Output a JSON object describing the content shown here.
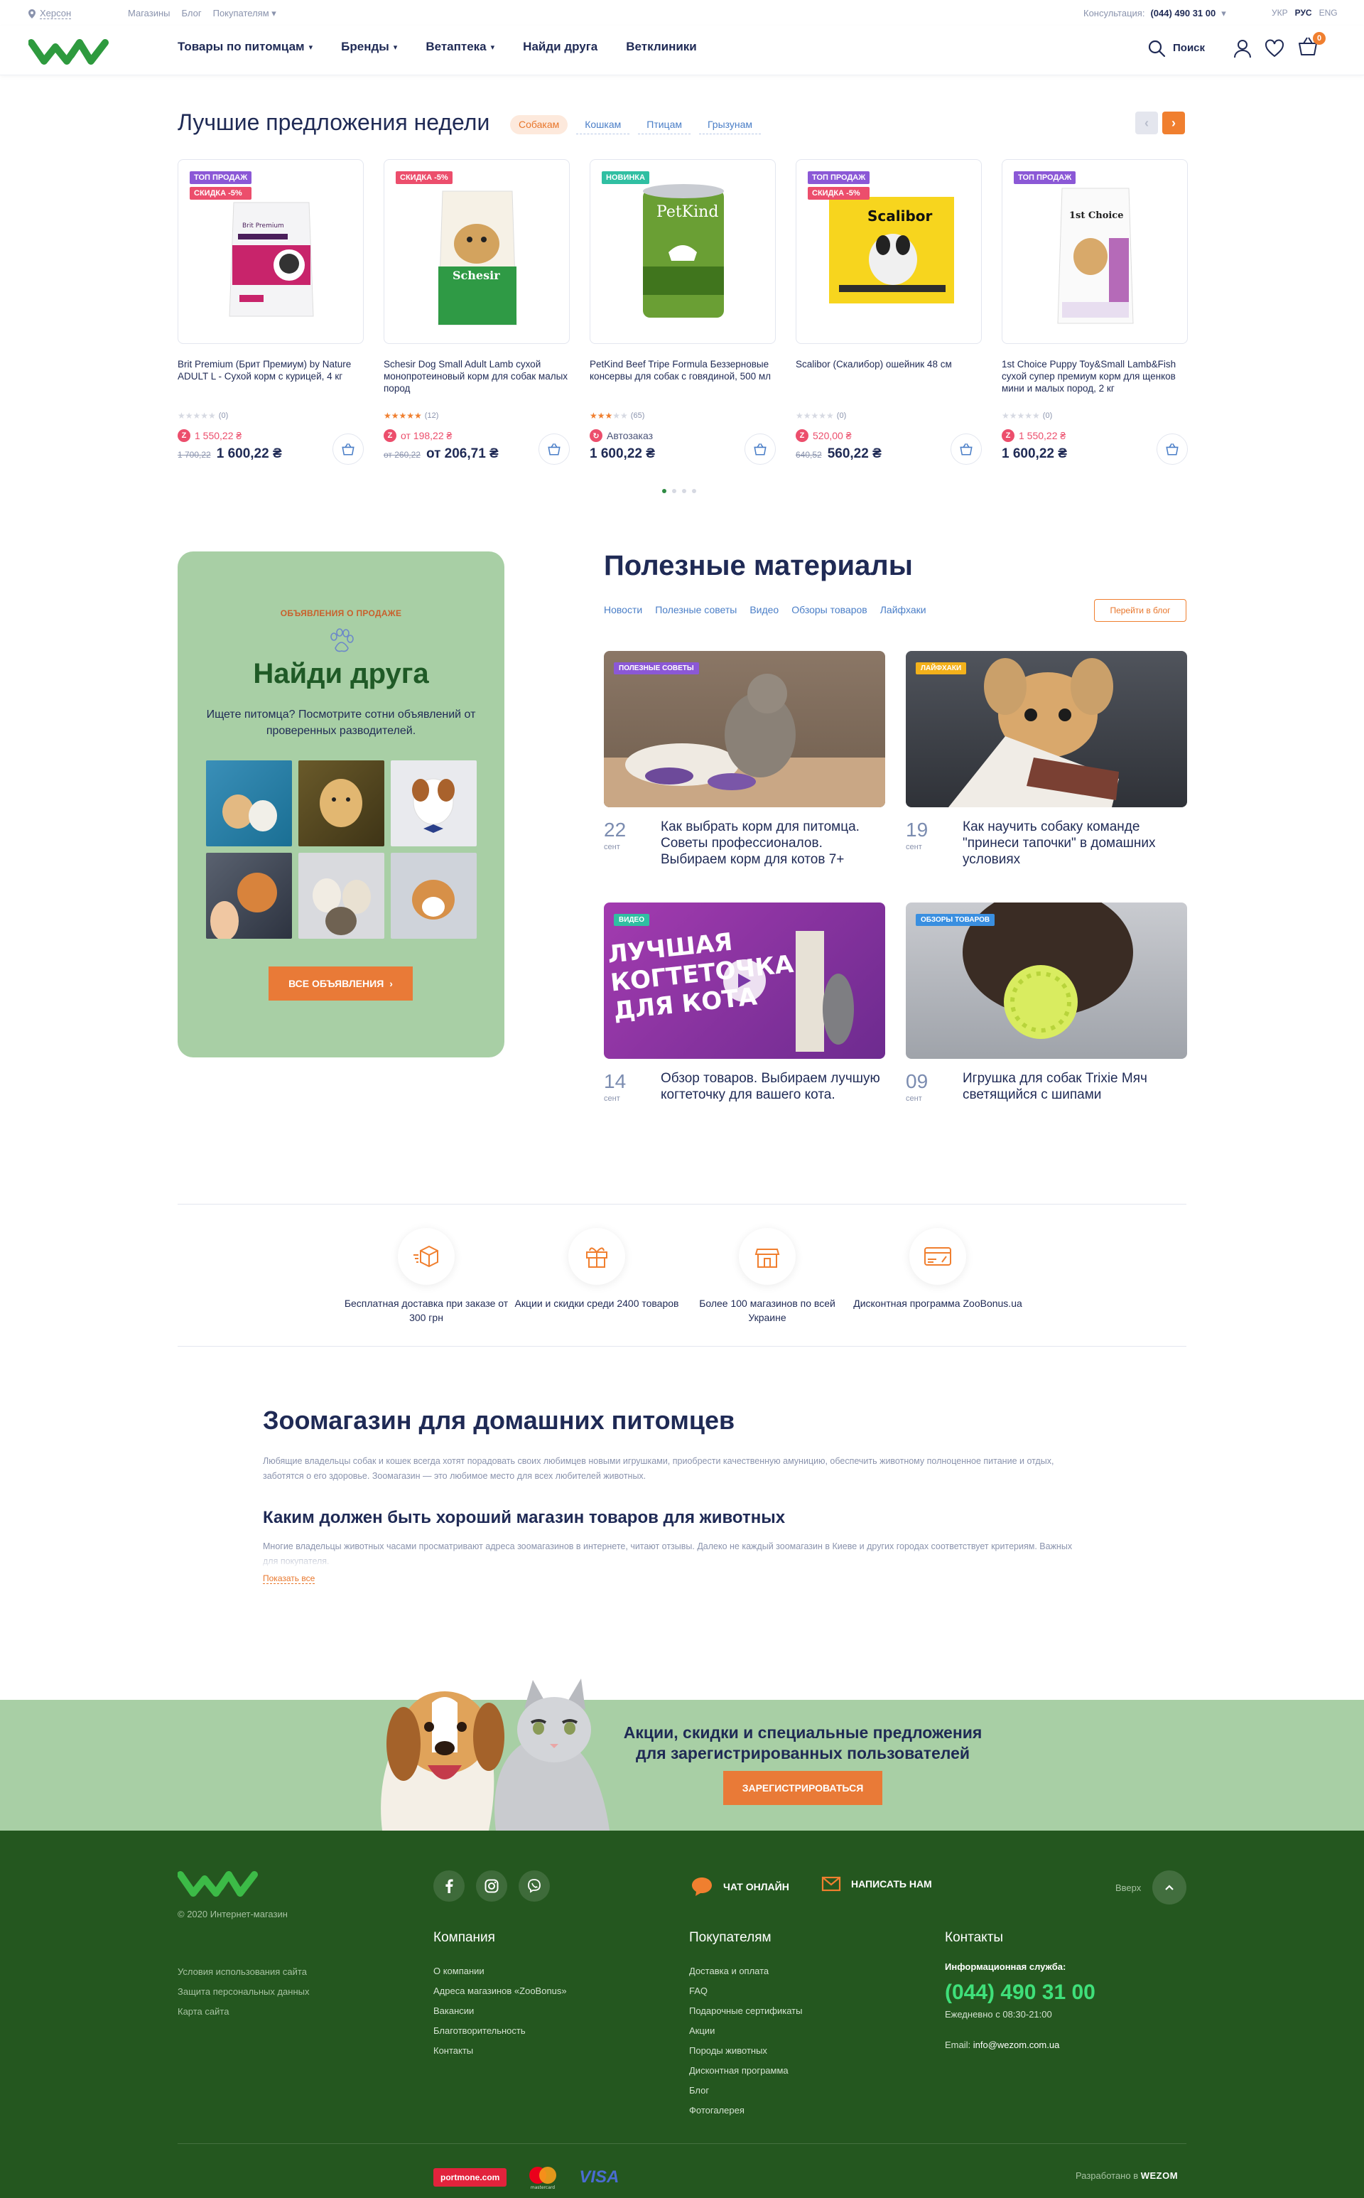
{
  "header": {
    "city": "Херсон",
    "top_links": [
      "Магазины",
      "Блог",
      "Покупателям"
    ],
    "consult_label": "Консультация:",
    "consult_phone": "(044) 490 31 00",
    "langs": [
      "УКР",
      "РУС",
      "ENG"
    ],
    "nav": [
      "Товары по питомцам",
      "Бренды",
      "Ветаптека",
      "Найди друга",
      "Ветклиники"
    ],
    "search_label": "Поиск",
    "cart_count": "0"
  },
  "offers": {
    "title": "Лучшие предложения недели",
    "tabs": [
      "Собакам",
      "Кошкам",
      "Птицам",
      "Грызунам"
    ],
    "products": [
      {
        "badges": [
          "ТОП ПРОДАЖ",
          "СКИДКА -5%"
        ],
        "name": "Brit Premium (Брит Премиум) by Nature ADULT L - Сухой корм с курицей, 4 кг",
        "reviews": "(0)",
        "bonus": "1 550,22 ₴",
        "old": "1 700,22",
        "price": "1 600,22 ₴"
      },
      {
        "badges": [
          "СКИДКА -5%"
        ],
        "name": "Schesir Dog Small Adult Lamb сухой монопротеиновый корм для собак малых пород",
        "reviews": "(12)",
        "bonus": "от 198,22 ₴",
        "old": "от 260,22",
        "price": "от 206,71 ₴"
      },
      {
        "badges": [
          "НОВИНКА"
        ],
        "name": "PetKind Beef Tripe Formula Беззерновые консервы для собак с говядиной, 500 мл",
        "reviews": "(65)",
        "bonus": "Автозаказ",
        "old": "",
        "price": "1 600,22 ₴"
      },
      {
        "badges": [
          "ТОП ПРОДАЖ",
          "СКИДКА -5%"
        ],
        "name": "Scalibor (Скалибор) ошейник 48 см",
        "reviews": "(0)",
        "bonus": "520,00 ₴",
        "old": "640,52",
        "price": "560,22 ₴"
      },
      {
        "badges": [
          "ТОП ПРОДАЖ"
        ],
        "name": "1st Choice Puppy Toy&Small Lamb&Fish сухой супер премиум корм для щенков мини и малых пород, 2 кг",
        "reviews": "(0)",
        "bonus": "1 550,22 ₴",
        "old": "",
        "price": "1 600,22 ₴"
      }
    ],
    "package_labels": [
      "Brit Premium",
      "Schesir",
      "PetKind",
      "Scalibor",
      "1st Choice"
    ],
    "ratings": [
      0,
      5,
      3,
      0,
      0
    ]
  },
  "friend": {
    "kicker": "ОБЪЯВЛЕНИЯ О ПРОДАЖЕ",
    "title": "Найди друга",
    "desc": "Ищете питомца? Посмотрите сотни объявлений от проверенных разводителей.",
    "button": "ВСЕ ОБЪЯВЛЕНИЯ"
  },
  "blog": {
    "title": "Полезные материалы",
    "tabs": [
      "Новости",
      "Полезные советы",
      "Видео",
      "Обзоры товаров",
      "Лайфхаки"
    ],
    "button": "Перейти в блог",
    "articles": [
      {
        "tag": "ПОЛЕЗНЫЕ СОВЕТЫ",
        "day": "22",
        "month": "сент",
        "title": "Как выбрать корм для питомца. Советы профессионалов. Выбираем корм для котов 7+"
      },
      {
        "tag": "ЛАЙФХАКИ",
        "day": "19",
        "month": "сент",
        "title": "Как научить собаку команде \"принеси тапочки\" в домашних условиях"
      },
      {
        "tag": "ВИДЕО",
        "day": "14",
        "month": "сент",
        "title": "Обзор товаров. Выбираем лучшую когтеточку для вашего кота."
      },
      {
        "tag": "ОБЗОРЫ ТОВАРОВ",
        "day": "09",
        "month": "сент",
        "title": "Игрушка для собак Trixie Мяч светящийся с шипами"
      }
    ],
    "video_text": [
      "ЛУЧШАЯ",
      "КОГТЕТОЧКА",
      "ДЛЯ КОТА"
    ]
  },
  "features": [
    {
      "icon": "delivery-box-icon",
      "text": "Бесплатная доставка при заказе от 300 грн"
    },
    {
      "icon": "gift-icon",
      "text": "Акции и скидки среди 2400 товаров"
    },
    {
      "icon": "store-icon",
      "text": "Более 100 магазинов по всей Украине"
    },
    {
      "icon": "discount-card-icon",
      "text": "Дисконтная программа ZooBonus.ua"
    }
  ],
  "seo": {
    "h1": "Зоомагазин для домашних питомцев",
    "p1": "Любящие владельцы собак и кошек всегда хотят порадовать своих любимцев новыми игрушками, приобрести качественную амуницию, обеспечить животному полноценное питание и отдых, заботятся о его здоровье. Зоомагазин — это любимое место для всех любителей животных.",
    "h2": "Каким должен быть хороший магазин товаров для животных",
    "p2": "Многие владельцы животных часами просматривают адреса зоомагазинов в интернете, читают отзывы. Далеко не каждый зоомагазин в Киеве и других городах соответствует критериям. Важных для покупателя.",
    "more": "Показать все"
  },
  "promo": {
    "text": "Акции, скидки и специальные предложения для зарегистрированных пользователей",
    "button": "ЗАРЕГИСТРИРОВАТЬСЯ"
  },
  "footer": {
    "copy": "© 2020 Интернет-магазин",
    "chat": "ЧАТ ОНЛАЙН",
    "write": "НАПИСАТЬ НАМ",
    "up": "Вверх",
    "legal": [
      "Условия использования сайта",
      "Защита персональных данных",
      "Карта сайта"
    ],
    "company_title": "Компания",
    "company": [
      "О компании",
      "Адреса магазинов «ZooBonus»",
      "Вакансии",
      "Благотворительность",
      "Контакты"
    ],
    "buyers_title": "Покупателям",
    "buyers": [
      "Доставка и оплата",
      "FAQ",
      "Подарочные сертификаты",
      "Акции",
      "Породы животных",
      "Дисконтная программа",
      "Блог",
      "Фотогалерея"
    ],
    "contacts_title": "Контакты",
    "info_label": "Информационная служба:",
    "phone": "(044) 490 31 00",
    "hours": "Ежедневно с 08:30-21:00",
    "email_label": "Email:",
    "email": "info@wezom.com.ua",
    "portmone": "portmone.com",
    "mastercard_caption": "mastercard",
    "visa": "VISA",
    "dev_label": "Разработано в",
    "dev": "WEZOM"
  },
  "colors": {
    "accent": "#f07f2f",
    "brand_green": "#2e8b43",
    "footer_bg": "#24571f",
    "panel_green": "#a8cfa5",
    "navy": "#1f2a55"
  }
}
